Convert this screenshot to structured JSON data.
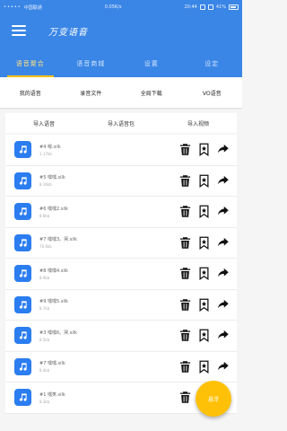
{
  "status": {
    "signal": "•••••",
    "net": "中国联通",
    "speed": "0.05K/s",
    "time": "20:44",
    "battery_pct": "41%"
  },
  "header": {
    "title": "万变语音"
  },
  "tabs": [
    {
      "label": "语音聚合",
      "active": true
    },
    {
      "label": "语音商城",
      "active": false
    },
    {
      "label": "设置",
      "active": false
    },
    {
      "label": "设定",
      "active": false
    }
  ],
  "subtabs": [
    {
      "label": "我的语音"
    },
    {
      "label": "录音文件"
    },
    {
      "label": "全局下载"
    },
    {
      "label": "VO语音"
    }
  ],
  "actions": [
    {
      "label": "导入语音"
    },
    {
      "label": "导入语音包"
    },
    {
      "label": "导入视频"
    }
  ],
  "list": {
    "items": [
      {
        "name": "#4 嗯.silk",
        "size": "1.17kb"
      },
      {
        "name": "#5 嘿嘿.silk",
        "size": "8.16kb"
      },
      {
        "name": "#6 嘿嘿2.silk",
        "size": "8.8kb"
      },
      {
        "name": "#7 嘿嘿3。哭.silk",
        "size": "76.6kb"
      },
      {
        "name": "#8 嘿嘿4.silk",
        "size": "8.9kb"
      },
      {
        "name": "#9 嘿嘿5.silk",
        "size": "8.7kb"
      },
      {
        "name": "#3 嘿嘿6。哭.silk",
        "size": "8.5kb"
      },
      {
        "name": "#7 嘿嘿.silk",
        "size": "8.4kb"
      },
      {
        "name": "#1 嘿笑.silk",
        "size": "8.3kb"
      }
    ]
  },
  "fab": {
    "label": "悬浮"
  },
  "colors": {
    "primary": "#3a86e6",
    "accent": "#ffc107",
    "icon_bg": "#2b7df0"
  },
  "icons": {
    "row_icon": "music-note-icon",
    "delete": "trash-icon",
    "favorite": "bookmark-star-icon",
    "share": "share-icon",
    "menu": "hamburger-menu-icon"
  }
}
